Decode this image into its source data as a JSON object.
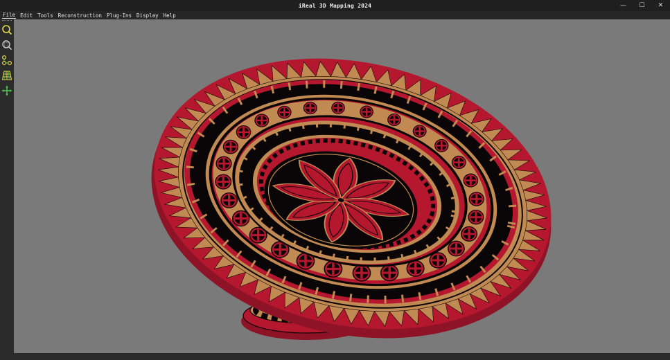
{
  "window": {
    "title": "iReal 3D Mapping 2024",
    "controls": {
      "minimize": "—",
      "maximize": "☐",
      "close": "✕"
    }
  },
  "menu": {
    "items": [
      {
        "label": "File"
      },
      {
        "label": "Edit"
      },
      {
        "label": "Tools"
      },
      {
        "label": "Reconstruction"
      },
      {
        "label": "Plug-Ins"
      },
      {
        "label": "Display"
      },
      {
        "label": "Help"
      }
    ]
  },
  "toolbar": {
    "tools": [
      {
        "icon": "zoom-icon"
      },
      {
        "icon": "zoom-region-icon"
      },
      {
        "icon": "point-connect-icon"
      },
      {
        "icon": "mesh-grid-icon"
      },
      {
        "icon": "move-axis-icon"
      }
    ]
  },
  "viewport": {
    "model": "decorated-bowl",
    "colors": {
      "red": "#b5172e",
      "gold": "#c08a52",
      "black": "#0a0506",
      "background": "#7a7a7a"
    }
  }
}
